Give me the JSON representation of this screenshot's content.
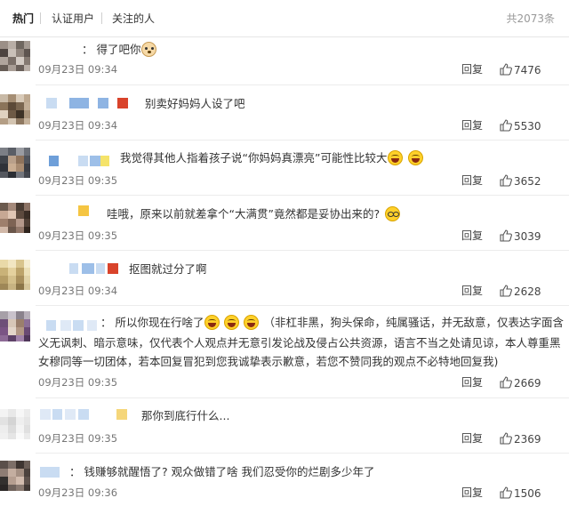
{
  "tabs": [
    {
      "label": "热门",
      "active": true
    },
    {
      "label": "认证用户",
      "active": false
    },
    {
      "label": "关注的人",
      "active": false
    }
  ],
  "total_label": "共2073条",
  "reply_label": "回复",
  "comments": [
    {
      "text": "：  得了吧你",
      "emoji_after": [
        "dog-face-icon"
      ],
      "time": "09月23日 09:34",
      "likes": "7476"
    },
    {
      "text": "别卖好妈妈人设了吧",
      "time": "09月23日 09:34",
      "likes": "5530"
    },
    {
      "text": "我觉得其他人指着孩子说“你妈妈真漂亮”可能性比较大",
      "emoji_after": [
        "laughing-face-icon",
        "laughing-face-icon"
      ],
      "time": "09月23日 09:35",
      "likes": "3652"
    },
    {
      "text": "哇哦，原来以前就差拿个“大满贯”竟然都是妥协出来的?",
      "emoji_after": [
        "glasses-face-icon"
      ],
      "time": "09月23日 09:35",
      "likes": "3039"
    },
    {
      "text": "抠图就过分了啊",
      "time": "09月23日 09:34",
      "likes": "2628"
    },
    {
      "text_prefix": "：  所以你现在行啥了",
      "emoji_mid": [
        "laughing-face-icon",
        "laughing-face-icon",
        "laughing-face-icon"
      ],
      "text_line1_rest": "（非杠非黑，狗头保命，纯属骚话，并无敌意，仅表达字面含",
      "text_line2": "义无讽刺、暗示意味，仅代表个人观点并无意引发论战及侵占公共资源，语言不当之处请见谅，本人尊重黑",
      "text_line3": "女穆同等一切团体，若本回复冒犯到您我诚挚表示歉意，若您不赞同我的观点不必特地回复我)",
      "time": "09月23日 09:35",
      "likes": "2669"
    },
    {
      "text": "那你到底行什么...",
      "time": "09月23日 09:35",
      "likes": "2369"
    },
    {
      "text": "：  钱赚够就醒悟了? 观众做错了啥 我们忍受你的烂剧多少年了",
      "time": "09月23日 09:36",
      "likes": "1506"
    }
  ],
  "colors": {
    "accent_blue": "#8eb4e3",
    "accent_red": "#d9432b",
    "accent_yellow": "#f5c542",
    "text": "#333333",
    "meta": "#777777"
  }
}
